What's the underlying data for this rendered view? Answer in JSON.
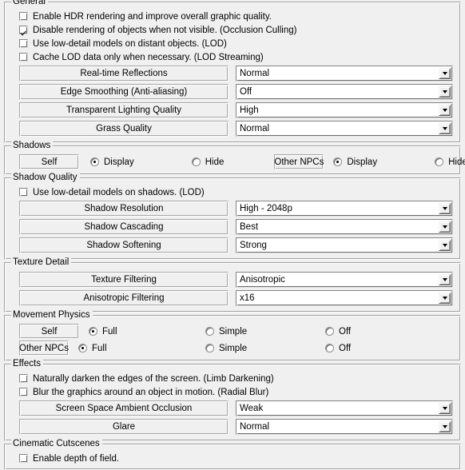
{
  "groups": {
    "general": {
      "title": "General",
      "checkboxes": [
        {
          "label": "Enable HDR rendering and improve overall graphic quality.",
          "checked": false
        },
        {
          "label": "Disable rendering of objects when not visible. (Occlusion Culling)",
          "checked": true
        },
        {
          "label": "Use low-detail models on distant objects. (LOD)",
          "checked": false
        },
        {
          "label": "Cache LOD data only when necessary. (LOD Streaming)",
          "checked": false
        }
      ],
      "settings": [
        {
          "label": "Real-time Reflections",
          "value": "Normal"
        },
        {
          "label": "Edge Smoothing (Anti-aliasing)",
          "value": "Off"
        },
        {
          "label": "Transparent Lighting Quality",
          "value": "High"
        },
        {
          "label": "Grass Quality",
          "value": "Normal"
        }
      ]
    },
    "shadows": {
      "title": "Shadows",
      "self_label": "Self",
      "self_options": [
        {
          "label": "Display",
          "selected": true
        },
        {
          "label": "Hide",
          "selected": false
        }
      ],
      "other_label": "Other NPCs",
      "other_options": [
        {
          "label": "Display",
          "selected": true
        },
        {
          "label": "Hide",
          "selected": false
        }
      ]
    },
    "shadow_quality": {
      "title": "Shadow Quality",
      "checkboxes": [
        {
          "label": "Use low-detail models on shadows. (LOD)",
          "checked": false
        }
      ],
      "settings": [
        {
          "label": "Shadow Resolution",
          "value": "High - 2048p"
        },
        {
          "label": "Shadow Cascading",
          "value": "Best"
        },
        {
          "label": "Shadow Softening",
          "value": "Strong"
        }
      ]
    },
    "texture_detail": {
      "title": "Texture Detail",
      "settings": [
        {
          "label": "Texture Filtering",
          "value": "Anisotropic"
        },
        {
          "label": "Anisotropic Filtering",
          "value": "x16"
        }
      ]
    },
    "movement_physics": {
      "title": "Movement Physics",
      "self_label": "Self",
      "self_options": [
        {
          "label": "Full",
          "selected": true
        },
        {
          "label": "Simple",
          "selected": false
        },
        {
          "label": "Off",
          "selected": false
        }
      ],
      "other_label": "Other NPCs",
      "other_options": [
        {
          "label": "Full",
          "selected": true
        },
        {
          "label": "Simple",
          "selected": false
        },
        {
          "label": "Off",
          "selected": false
        }
      ]
    },
    "effects": {
      "title": "Effects",
      "checkboxes": [
        {
          "label": "Naturally darken the edges of the screen. (Limb Darkening)",
          "checked": false
        },
        {
          "label": "Blur the graphics around an object in motion. (Radial Blur)",
          "checked": false
        }
      ],
      "settings": [
        {
          "label": "Screen Space Ambient Occlusion",
          "value": "Weak"
        },
        {
          "label": "Glare",
          "value": "Normal"
        }
      ]
    },
    "cinematic_cutscenes": {
      "title": "Cinematic Cutscenes",
      "checkboxes": [
        {
          "label": "Enable depth of field.",
          "checked": false
        }
      ]
    }
  },
  "colors": {
    "window_background": "#f0f0f0",
    "field_background": "#ffffff",
    "border": "#a0a0a0",
    "text": "#000000"
  }
}
